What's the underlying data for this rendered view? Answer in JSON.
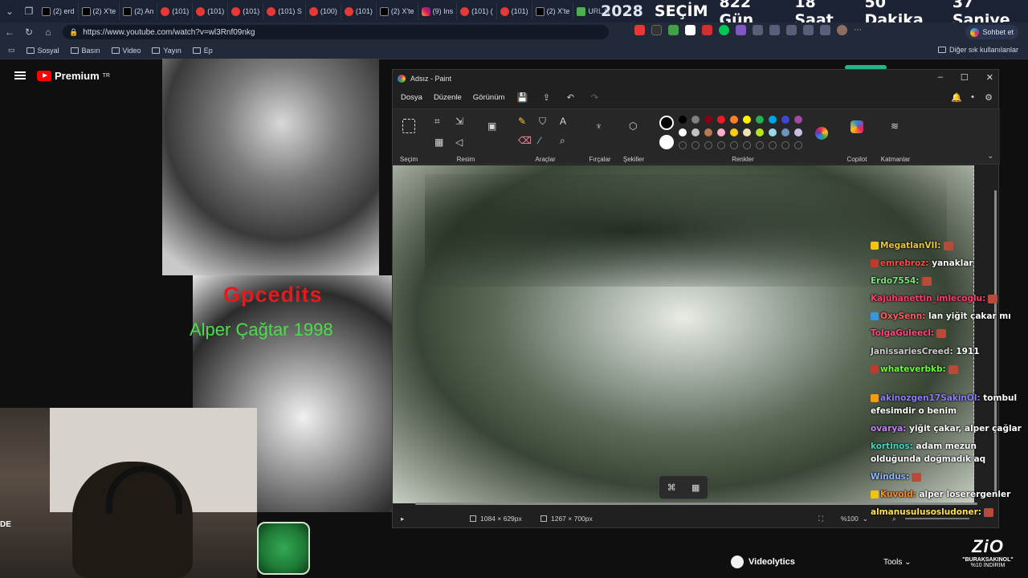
{
  "tabs": [
    {
      "label": "(2) erd",
      "icon": "x"
    },
    {
      "label": "(2) X'te",
      "icon": "x"
    },
    {
      "label": "(2) An",
      "icon": "x"
    },
    {
      "label": "(101)",
      "icon": "yt"
    },
    {
      "label": "(101)",
      "icon": "yt"
    },
    {
      "label": "(101)",
      "icon": "yt"
    },
    {
      "label": "(101) S",
      "icon": "yt"
    },
    {
      "label": "(100)",
      "icon": "yt"
    },
    {
      "label": "(101)",
      "icon": "yt"
    },
    {
      "label": "(2) X'te",
      "icon": "x"
    },
    {
      "label": "(9) Ins",
      "icon": "ig"
    },
    {
      "label": "(101) (",
      "icon": "yt"
    },
    {
      "label": "(101)",
      "icon": "yt"
    },
    {
      "label": "(2) X'te",
      "icon": "x"
    },
    {
      "label": "URL N",
      "icon": "g"
    }
  ],
  "countdown": {
    "year": "2028",
    "label": "SEÇİM",
    "days": "822 Gün",
    "hours": "18 Saat",
    "minutes": "50 Dakika",
    "seconds": "37 Saniye"
  },
  "address": {
    "url": "https://www.youtube.com/watch?v=wl3Rnf09nkg",
    "chat_button": "Sohbet et"
  },
  "bookmarks": {
    "items": [
      "Sosyal",
      "Basın",
      "Video",
      "Yayın",
      "Ep"
    ],
    "other": "Diğer sık kullanılanlar"
  },
  "youtube": {
    "brand": "Premium",
    "region": "TR"
  },
  "video_overlay": {
    "title": "Gpcedits",
    "subtitle": "Alper Çağtar 1998"
  },
  "webcam": {
    "badge": "DE"
  },
  "paint": {
    "window_title": "Adsız - Paint",
    "menus": [
      "Dosya",
      "Düzenle",
      "Görünüm"
    ],
    "groups": {
      "selection": "Seçim",
      "image": "Resim",
      "tools": "Araçlar",
      "brushes": "Fırçalar",
      "shapes": "Şekiller",
      "colors": "Renkler",
      "copilot": "Copilot",
      "layers": "Katmanlar"
    },
    "palette_row1": [
      "#000000",
      "#7f7f7f",
      "#880015",
      "#ed1c24",
      "#ff7f27",
      "#fff200",
      "#22b14c",
      "#00a2e8",
      "#3f48cc",
      "#a349a4"
    ],
    "palette_row2": [
      "#ffffff",
      "#c3c3c3",
      "#b97a57",
      "#ffaec9",
      "#ffc90e",
      "#efe4b0",
      "#b5e61d",
      "#99d9ea",
      "#7092be",
      "#c8bfe7"
    ],
    "primary_color": "#000000",
    "secondary_color": "#ffffff",
    "status": {
      "selection_size": "1084 × 629px",
      "canvas_size": "1267 × 700px",
      "zoom": "%100"
    }
  },
  "chat": [
    {
      "user": "MegatlanVII:",
      "text": "",
      "color": "#e8c53a",
      "badge": "#f1c40f",
      "emote": true
    },
    {
      "user": "emrebroz:",
      "text": "yanaklar",
      "color": "#ff4a4a",
      "badge": "#c0392b",
      "emote": false
    },
    {
      "user": "Erdo7554:",
      "text": "",
      "color": "#7fe07f",
      "badge": "",
      "emote": true
    },
    {
      "user": "Kajuhanettin_imlecoglu:",
      "text": "",
      "color": "#ff3b6b",
      "badge": "",
      "emote": true
    },
    {
      "user": "OxySenn:",
      "text": "lan yiğit çakar mı",
      "color": "#ff5e5e",
      "badge": "#3498db",
      "emote": false
    },
    {
      "user": "TolgaGuleecl:",
      "text": "",
      "color": "#ff4a7a",
      "badge": "",
      "emote": true
    },
    {
      "user": "JanissariesCreed:",
      "text": "1911",
      "color": "#cfcfcf",
      "badge": "",
      "emote": false
    },
    {
      "user": "whateverbkb:",
      "text": "",
      "color": "#66ff33",
      "badge": "#c0392b",
      "emote": true
    },
    {
      "user": "akinozgen17SakinOl:",
      "text": "tombul efesimdir o benim",
      "color": "#8e7dff",
      "badge": "#f39c12",
      "emote": false
    },
    {
      "user": "ovarya:",
      "text": "yiğit çakar, alper çağlar",
      "color": "#c77dff",
      "badge": "",
      "emote": false
    },
    {
      "user": "kortinos:",
      "text": "adam mezun olduğunda doğmadık aq",
      "color": "#3fd8c0",
      "badge": "",
      "emote": false
    },
    {
      "user": "Windus:",
      "text": "",
      "color": "#8fb7ff",
      "badge": "",
      "emote": true
    },
    {
      "user": "Kuvold:",
      "text": "alper loserergenler",
      "color": "#ff8a1f",
      "badge": "#f1c40f",
      "emote": false
    },
    {
      "user": "almanusulusosludoner:",
      "text": "",
      "color": "#ffe14a",
      "badge": "",
      "emote": true
    }
  ],
  "bottom": {
    "videolytics": "Videolytics",
    "tools": "Tools",
    "promo_logo": "ZiO",
    "promo_code": "\"BURAKSAKINOL\"",
    "promo_discount": "%10 İNDİRİM"
  }
}
